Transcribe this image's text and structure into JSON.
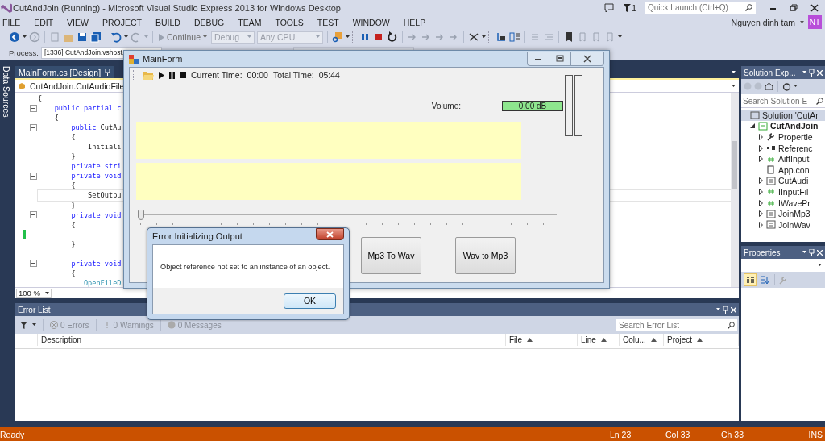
{
  "window": {
    "title": "CutAndJoin (Running) - Microsoft Visual Studio Express 2013 for Windows Desktop"
  },
  "notifications": {
    "count": "1"
  },
  "quick_launch": {
    "placeholder": "Quick Launch (Ctrl+Q)"
  },
  "menu": [
    "FILE",
    "EDIT",
    "VIEW",
    "PROJECT",
    "BUILD",
    "DEBUG",
    "TEAM",
    "TOOLS",
    "TEST",
    "WINDOW",
    "HELP"
  ],
  "user": {
    "name": "Nguyen dinh tam",
    "initials": "NT"
  },
  "toolbar": {
    "continue": "Continue",
    "configuration": {
      "value": "Debug",
      "disabled": true
    },
    "platform": {
      "value": "Any CPU",
      "disabled": true
    }
  },
  "process": {
    "label": "Process:",
    "value": "[1336] CutAndJoin.vshost."
  },
  "side_strip": "Data Sources",
  "editor": {
    "tab": "MainForm.cs [Design]",
    "navigation": "CutAndJoin.CutAudioFile",
    "zoom": "100 %",
    "lines": [
      {
        "segments": [
          {
            "text": "{",
            "kind": "plain"
          }
        ],
        "fold": false,
        "current": false,
        "changed": false
      },
      {
        "segments": [
          {
            "text": "    public partial c",
            "kind": "keyword"
          }
        ],
        "fold": true,
        "current": false,
        "changed": false
      },
      {
        "segments": [
          {
            "text": "    {",
            "kind": "plain"
          }
        ],
        "fold": false,
        "current": false,
        "changed": false
      },
      {
        "segments": [
          {
            "text": "        public",
            "kind": "keyword"
          },
          {
            "text": " CutAu",
            "kind": "plain"
          }
        ],
        "fold": true,
        "current": false,
        "changed": false
      },
      {
        "segments": [
          {
            "text": "        {",
            "kind": "plain"
          }
        ],
        "fold": false,
        "current": false,
        "changed": false
      },
      {
        "segments": [
          {
            "text": "            Initiali",
            "kind": "plain"
          }
        ],
        "fold": false,
        "current": false,
        "changed": false
      },
      {
        "segments": [
          {
            "text": "        }",
            "kind": "plain"
          }
        ],
        "fold": false,
        "current": false,
        "changed": false
      },
      {
        "segments": [
          {
            "text": "        private stri",
            "kind": "keyword"
          }
        ],
        "fold": false,
        "current": false,
        "changed": false
      },
      {
        "segments": [
          {
            "text": "        private void",
            "kind": "keyword"
          }
        ],
        "fold": true,
        "current": false,
        "changed": false
      },
      {
        "segments": [
          {
            "text": "        {",
            "kind": "plain"
          }
        ],
        "fold": false,
        "current": false,
        "changed": false
      },
      {
        "segments": [
          {
            "text": "            SetOutpu",
            "kind": "plain"
          }
        ],
        "fold": false,
        "current": true,
        "changed": false
      },
      {
        "segments": [
          {
            "text": "        }",
            "kind": "plain"
          }
        ],
        "fold": false,
        "current": false,
        "changed": false
      },
      {
        "segments": [
          {
            "text": "        private void",
            "kind": "keyword"
          }
        ],
        "fold": true,
        "current": false,
        "changed": false
      },
      {
        "segments": [
          {
            "text": "        {",
            "kind": "plain"
          }
        ],
        "fold": false,
        "current": false,
        "changed": false
      },
      {
        "fold": false,
        "current": false,
        "changed": true
      },
      {
        "segments": [
          {
            "text": "        }",
            "kind": "plain"
          }
        ],
        "fold": false,
        "current": false,
        "changed": false
      },
      {
        "fold": false,
        "current": false,
        "changed": false
      },
      {
        "segments": [
          {
            "text": "        private void",
            "kind": "keyword"
          }
        ],
        "fold": true,
        "current": false,
        "changed": false
      },
      {
        "segments": [
          {
            "text": "        {",
            "kind": "plain"
          }
        ],
        "fold": false,
        "current": false,
        "changed": false
      },
      {
        "segments": [
          {
            "text": "           OpenFileD",
            "kind": "type"
          }
        ],
        "fold": false,
        "current": false,
        "changed": false
      }
    ]
  },
  "error_list": {
    "title": "Error List",
    "filters": [
      {
        "label": "0 Errors",
        "kind": "errors"
      },
      {
        "label": "0 Warnings",
        "kind": "warnings"
      },
      {
        "label": "0 Messages",
        "kind": "messages"
      }
    ],
    "search": {
      "placeholder": "Search Error List"
    },
    "columns": [
      {
        "label": "Description",
        "sort_arrow": false
      },
      {
        "label": "File",
        "sort_arrow": true
      },
      {
        "label": "Line",
        "sort_arrow": true
      },
      {
        "label": "Colu...",
        "sort_arrow": true
      },
      {
        "label": "Project",
        "sort_arrow": true
      }
    ]
  },
  "solution_explorer": {
    "title": "Solution Exp...",
    "search": {
      "placeholder": "Search Solution E"
    },
    "tree": [
      {
        "label": "Solution 'CutAr",
        "kind": "solution",
        "expandable": false,
        "selected": true,
        "children": [
          {
            "label": "CutAndJoin",
            "kind": "project",
            "expandable": true,
            "expanded": true,
            "selected": false,
            "children": [
              {
                "label": "Propertie",
                "kind": "properties",
                "expandable": true,
                "expanded": false,
                "selected": false
              },
              {
                "label": "Referenc",
                "kind": "references",
                "expandable": true,
                "expanded": false,
                "selected": false
              },
              {
                "label": "AiffInput",
                "kind": "code",
                "expandable": true,
                "expanded": false,
                "selected": false
              },
              {
                "label": "App.con",
                "kind": "config",
                "expandable": false,
                "selected": false
              },
              {
                "label": "CutAudi",
                "kind": "form",
                "expandable": true,
                "expanded": false,
                "selected": false
              },
              {
                "label": "IInputFil",
                "kind": "code",
                "expandable": true,
                "expanded": false,
                "selected": false
              },
              {
                "label": "IWavePr",
                "kind": "code",
                "expandable": true,
                "expanded": false,
                "selected": false
              },
              {
                "label": "JoinMp3",
                "kind": "form",
                "expandable": true,
                "expanded": false,
                "selected": false
              },
              {
                "label": "JoinWav",
                "kind": "form",
                "expandable": true,
                "expanded": false,
                "selected": false
              }
            ]
          }
        ]
      }
    ]
  },
  "properties": {
    "title": "Properties",
    "views": [
      {
        "kind": "categorized",
        "selected": true
      },
      {
        "kind": "alphabetical",
        "selected": false
      }
    ]
  },
  "status_bar": {
    "message": "Ready",
    "line": "Ln 23",
    "column": "Col 33",
    "char": "Ch 33",
    "mode": "INS"
  },
  "main_form": {
    "title": "MainForm",
    "current_time_label": "Current Time:",
    "current_time": "00:00",
    "total_time_label": "Total Time:",
    "total_time": "05:44",
    "volume_label": "Volume:",
    "volume": "0.00 dB",
    "meters": [
      {
        "level": 0
      },
      {
        "level": 0
      }
    ],
    "position": {
      "level": 0
    },
    "buttons": [
      "Mp3 To Wav",
      "Wav to Mp3"
    ]
  },
  "dialog": {
    "title": "Error Initializing Output",
    "message": "Object reference not set to an instance of an object.",
    "button": "OK"
  }
}
